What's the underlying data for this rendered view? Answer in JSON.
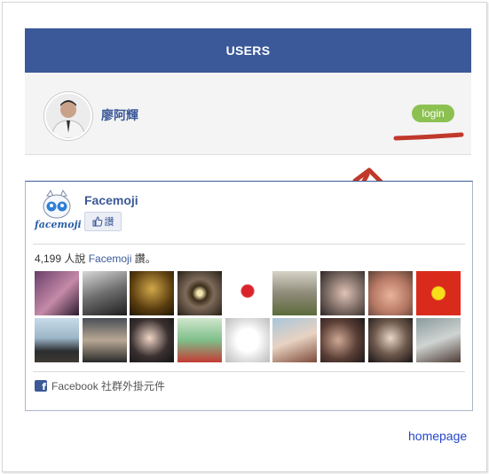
{
  "header": {
    "title": "USERS"
  },
  "user": {
    "name": "廖阿輝",
    "login_label": "login"
  },
  "like_box": {
    "page_name": "Facemoji",
    "logo_text": "facemoji",
    "like_label": "讚",
    "count_prefix": "4,199 人說 ",
    "count_link": "Facemoji",
    "count_suffix": " 讚。",
    "footer": "Facebook 社群外掛元件",
    "fans": [
      {
        "bg": "linear-gradient(135deg,#6a3f6b,#c58aa8 55%,#2b1a2e)"
      },
      {
        "bg": "linear-gradient(160deg,#d9d9d9,#6d6d6d 50%,#1e1e1e)"
      },
      {
        "bg": "radial-gradient(circle at 50% 40%,#d1a84a,#5a3d0f 60%,#1f1605)"
      },
      {
        "bg": "radial-gradient(ellipse at 50% 50%,#f4e6b0 8%,#3b2e1a 24%,#7e6a5a 45%,#262016)"
      },
      {
        "bg": "radial-gradient(circle at 50% 45%,#d9242b 18%,#ffffff 22%)"
      },
      {
        "bg": "linear-gradient(180deg,#d6d3c8,#8f8b7a 50%,#5c6b3a)"
      },
      {
        "bg": "radial-gradient(circle at 55% 50%,#e0c3b6,#7b6a63 55%,#2d2525)"
      },
      {
        "bg": "radial-gradient(circle at 50% 55%,#e9b39a,#b57864 55%,#5d4036)"
      },
      {
        "bg": "radial-gradient(circle at 50% 50%,#f7df1a 20%,#da2a1c 24%)"
      },
      {
        "bg": "linear-gradient(180deg,#c8dbe8,#9bb6c8 45%,#2b2d2f 75%,#3e3a33)"
      },
      {
        "bg": "linear-gradient(180deg,#4a4f57,#b8a894 50%,#2a2a2a)"
      },
      {
        "bg": "radial-gradient(circle at 45% 45%,#f0d6c5,#3a3030 55%,#141414)"
      },
      {
        "bg": "linear-gradient(180deg,#cfe6cc,#7fbf8a 50%,#c43b34)"
      },
      {
        "bg": "radial-gradient(circle at 50% 50%,#ffffff 35%,#e4e4e4 60%,#bdbdbd)"
      },
      {
        "bg": "linear-gradient(160deg,#a9c6da,#e8d2c2 50%,#7e4b3a)"
      },
      {
        "bg": "radial-gradient(circle at 40% 50%,#cfa894,#5a3f36 55%,#1e1818)"
      },
      {
        "bg": "radial-gradient(circle at 50% 45%,#ead7c6,#6f5a4e 50%,#181414)"
      },
      {
        "bg": "linear-gradient(160deg,#8a9a9c,#cfd4d2 50%,#4e3b35)"
      }
    ]
  },
  "footer_link": {
    "label": "homepage"
  },
  "colors": {
    "brand": "#3b5998",
    "login": "#8cc152",
    "annotation": "#c0392b",
    "link": "#2546c8"
  }
}
